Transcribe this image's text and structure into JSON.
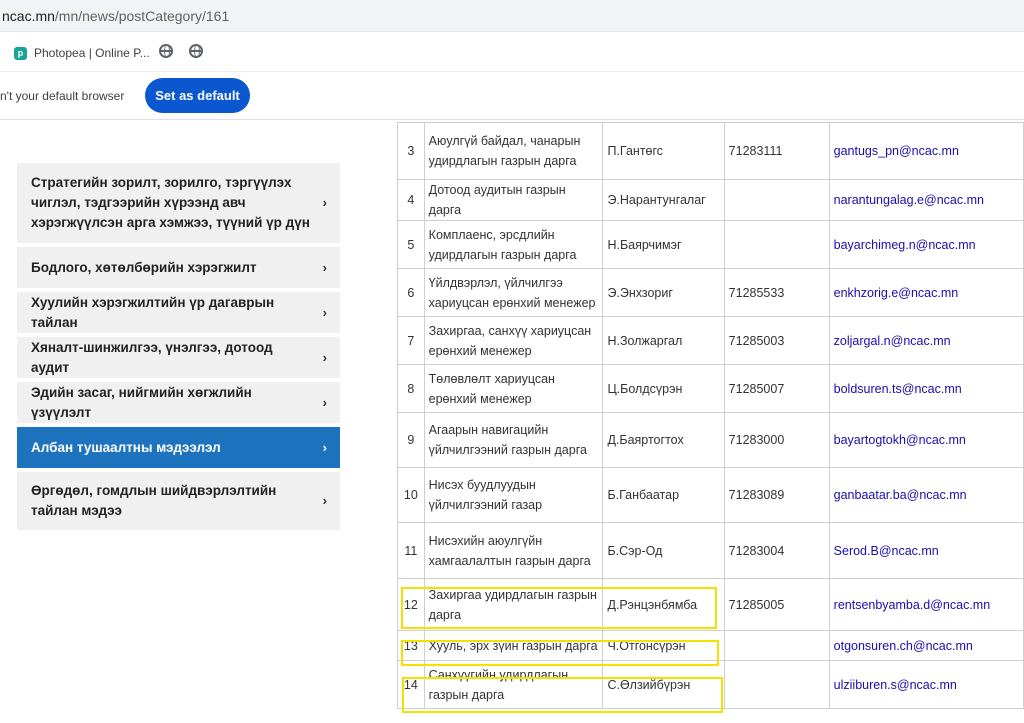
{
  "browser": {
    "url_host": "ncac.mn",
    "url_path": "/mn/news/postCategory/161",
    "bookmark_photopea": "Photopea | Online P...",
    "infobar_message": "n't your default browser",
    "set_default_label": "Set as default"
  },
  "menu": {
    "items": [
      {
        "label": "Стратегийн зорилт, зорилго, тэргүүлэх чиглэл, тэдгээрийн хүрээнд авч хэрэгжүүлсэн арга хэмжээ, түүний үр дүн"
      },
      {
        "label": "Бодлого, хөтөлбөрийн хэрэгжилт"
      },
      {
        "label": "Хуулийн хэрэгжилтийн үр дагаврын тайлан"
      },
      {
        "label": "Хяналт-шинжилгээ, үнэлгээ, дотоод аудит"
      },
      {
        "label": "Эдийн засаг, нийгмийн хөгжлийн үзүүлэлт"
      },
      {
        "label": "Албан тушаалтны мэдээлэл"
      },
      {
        "label": "Өргөдөл, гомдлын шийдвэрлэлтийн тайлан мэдээ"
      }
    ],
    "chevron": "›"
  },
  "table": {
    "rows": [
      {
        "n": "3",
        "position": "Аюулгүй байдал, чанарын удирдлагын газрын дарга",
        "name": "П.Гантөгс",
        "phone": "71283111",
        "email": "gantugs_pn@ncac.mn"
      },
      {
        "n": "4",
        "position": "Дотоод аудитын газрын дарга",
        "name": "Э.Нарантунгалаг",
        "phone": "",
        "email": "narantungalag.e@ncac.mn"
      },
      {
        "n": "5",
        "position": "Комплаенс, эрсдлийн удирдлагын газрын дарга",
        "name": "Н.Баярчимэг",
        "phone": "",
        "email": "bayarchimeg.n@ncac.mn"
      },
      {
        "n": "6",
        "position": "Үйлдвэрлэл, үйлчилгээ хариуцсан ерөнхий менежер",
        "name": "Э.Энхзориг",
        "phone": "71285533",
        "email": "enkhzorig.e@ncac.mn"
      },
      {
        "n": "7",
        "position": "Захиргаа, санхүү хариуцсан ерөнхий менежер",
        "name": "Н.Золжаргал",
        "phone": "71285003",
        "email": "zoljargal.n@ncac.mn"
      },
      {
        "n": "8",
        "position": "Төлөвлөлт хариуцсан ерөнхий менежер",
        "name": "Ц.Болдсүрэн",
        "phone": "71285007",
        "email": "boldsuren.ts@ncac.mn"
      },
      {
        "n": "9",
        "position": "Агаарын навигацийн үйлчилгээний газрын дарга",
        "name": "Д.Баяртогтох",
        "phone": "71283000",
        "email": "bayartogtokh@ncac.mn"
      },
      {
        "n": "10",
        "position": "Нисэх буудлуудын үйлчилгээний газар",
        "name": "Б.Ганбаатар",
        "phone": "71283089",
        "email": "ganbaatar.ba@ncac.mn"
      },
      {
        "n": "11",
        "position": "Нисэхийн аюулгүйн хамгаалалтын газрын дарга",
        "name": "Б.Сэр-Од",
        "phone": "71283004",
        "email": "Serod.B@ncac.mn"
      },
      {
        "n": "12",
        "position": "Захиргаа удирдлагын газрын дарга",
        "name": "Д.Рэнцэнбямба",
        "phone": "71285005",
        "email": "rentsenbyamba.d@ncac.mn"
      },
      {
        "n": "13",
        "position": "Хууль, эрх зүйн газрын дарга",
        "name": "Ч.Отгонсүрэн",
        "phone": "",
        "email": "otgonsuren.ch@ncac.mn"
      },
      {
        "n": "14",
        "position": "Санхүүгийн удирдлагын газрын дарга",
        "name": "С.Өлзийбүрэн",
        "phone": "",
        "email": "ulziiburen.s@ncac.mn"
      }
    ]
  },
  "colors": {
    "accent": "#1e73be",
    "highlight": "#f2e200",
    "button": "#0b57d0"
  }
}
